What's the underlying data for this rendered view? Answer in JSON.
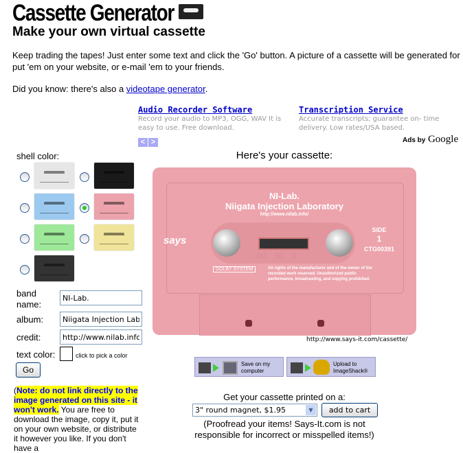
{
  "header": {
    "title": "Cassette Generator",
    "subtitle": "Make your own virtual cassette"
  },
  "intro": {
    "line1": "Keep trading the tapes! Just enter some text and click the 'Go' button. A picture of a cassette will be generated for",
    "line2": "put 'em on your website, or e-mail 'em to your friends.",
    "didyouknow": "Did you know: there's also a ",
    "link": "videotape generator",
    "after": "."
  },
  "ads": [
    {
      "title": "Audio Recorder Software",
      "desc": "Record your audio to MP3, OGG, WAV It is easy to use. Free download."
    },
    {
      "title": "Transcription Service",
      "desc": "Accurate transcripts; guarantee on- time delivery. Low rates/USA based."
    }
  ],
  "ads_prev": "<",
  "ads_next": ">",
  "ads_by": "Ads by",
  "ads_google": "Google",
  "form": {
    "shell_label": "shell color:",
    "shells": [
      {
        "name": "white",
        "color": "#e6e6e6"
      },
      {
        "name": "black",
        "color": "#1a1a1a"
      },
      {
        "name": "blue",
        "color": "#9cc9ef"
      },
      {
        "name": "pink",
        "color": "#eca3ac",
        "selected": true
      },
      {
        "name": "green",
        "color": "#9ee89a"
      },
      {
        "name": "yellow",
        "color": "#f0e49a"
      },
      {
        "name": "clear-black",
        "color": "#333333"
      }
    ],
    "band_label_1": "band",
    "band_label_2": "name:",
    "band_value": "NI-Lab.",
    "album_label": "album:",
    "album_value": "Niigata Injection Laboratory",
    "credit_label": "credit:",
    "credit_value": "http://www.nilab.info/",
    "textcolor_label": "text color:",
    "textcolor_hint": "click to pick a color",
    "go": "Go"
  },
  "note": {
    "open": "(",
    "hl": "Note: do not link directly to the image generated on this site - it won't work.",
    "rest": " You are free to download the image, copy it, put it on your own website, or distribute it however you like. If you don't have a"
  },
  "preview": {
    "heading": "Here's your cassette:",
    "band": "NI-Lab.",
    "album": "Niigata Injection Laboratory",
    "credit": "http://www.nilab.info/",
    "side_label": "SIDE",
    "side_num": "1",
    "code": "CTG00391",
    "brand": "says",
    "dolby": "DOLBY SYSTEM",
    "rights": "All rights of the manufacturer and of the owner of the recorded work reserved. Unauthorized public performance, broadcasting, and copying prohibited.",
    "counter": "100     50     0",
    "caption": "http://www.says-it.com/cassette/"
  },
  "actions": {
    "save_1": "Save on my",
    "save_2": "computer",
    "upload_1": "Upload to",
    "upload_2": "ImageShack®"
  },
  "print": {
    "label": "Get your cassette printed on a:",
    "selected": "3\" round magnet, $1.95",
    "add": "add to cart",
    "disclaimer_1": "(Proofread your items! Says-It.com is not",
    "disclaimer_2": "responsible for incorrect or misspelled items!)"
  }
}
